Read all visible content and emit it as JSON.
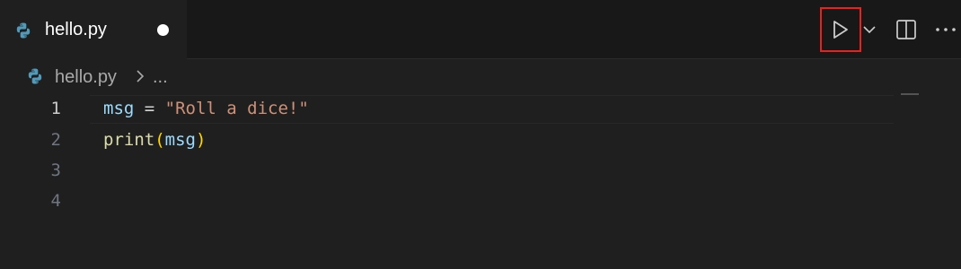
{
  "tab": {
    "file_name": "hello.py",
    "icon": "python-icon",
    "unsaved": true
  },
  "toolbar": {
    "run_icon": "play-icon",
    "dropdown_icon": "chevron-down-icon",
    "split_icon": "split-editor-icon",
    "more_icon": "ellipsis-icon",
    "highlight_color": "#e8221e"
  },
  "breadcrumb": {
    "file_name": "hello.py",
    "separator": "chevron-right-icon",
    "ellipsis": "..."
  },
  "editor": {
    "current_line": 1,
    "lines": [
      {
        "number": "1",
        "tokens": [
          {
            "text": "msg",
            "kind": "var"
          },
          {
            "text": " = ",
            "kind": "op"
          },
          {
            "text": "\"Roll a dice!\"",
            "kind": "str"
          }
        ]
      },
      {
        "number": "2",
        "tokens": [
          {
            "text": "print",
            "kind": "fn"
          },
          {
            "text": "(",
            "kind": "paren"
          },
          {
            "text": "msg",
            "kind": "var"
          },
          {
            "text": ")",
            "kind": "paren"
          }
        ]
      },
      {
        "number": "3",
        "tokens": []
      },
      {
        "number": "4",
        "tokens": []
      }
    ]
  },
  "colors": {
    "background": "#1f1f1f",
    "tabbar": "#181818",
    "string": "#ce9178",
    "variable": "#9cdcfe",
    "function": "#dcdcaa",
    "bracket": "#ffd700"
  }
}
